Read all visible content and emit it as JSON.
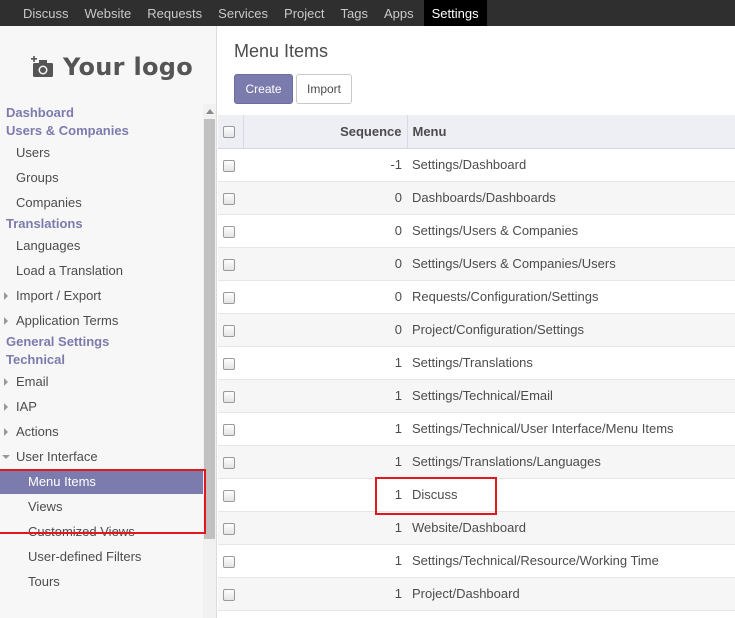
{
  "topnav": {
    "items": [
      "Discuss",
      "Website",
      "Requests",
      "Services",
      "Project",
      "Tags",
      "Apps",
      "Settings"
    ],
    "active": "Settings"
  },
  "sidebar": {
    "logo_text": "Your logo",
    "menu": [
      {
        "type": "section",
        "label": "Dashboard"
      },
      {
        "type": "section",
        "label": "Users & Companies"
      },
      {
        "type": "item",
        "label": "Users"
      },
      {
        "type": "item",
        "label": "Groups"
      },
      {
        "type": "item",
        "label": "Companies"
      },
      {
        "type": "section",
        "label": "Translations"
      },
      {
        "type": "item",
        "label": "Languages"
      },
      {
        "type": "item",
        "label": "Load a Translation"
      },
      {
        "type": "item",
        "label": "Import / Export",
        "caret": "right"
      },
      {
        "type": "item",
        "label": "Application Terms",
        "caret": "right"
      },
      {
        "type": "section",
        "label": "General Settings"
      },
      {
        "type": "section",
        "label": "Technical"
      },
      {
        "type": "item",
        "label": "Email",
        "caret": "right"
      },
      {
        "type": "item",
        "label": "IAP",
        "caret": "right"
      },
      {
        "type": "item",
        "label": "Actions",
        "caret": "right"
      },
      {
        "type": "item",
        "label": "User Interface",
        "caret": "down"
      },
      {
        "type": "subitem",
        "label": "Menu Items",
        "active": true
      },
      {
        "type": "subitem",
        "label": "Views"
      },
      {
        "type": "subitem",
        "label": "Customized Views"
      },
      {
        "type": "subitem",
        "label": "User-defined Filters"
      },
      {
        "type": "subitem",
        "label": "Tours"
      }
    ]
  },
  "main": {
    "title": "Menu Items",
    "create_label": "Create",
    "import_label": "Import",
    "columns": {
      "sequence": "Sequence",
      "menu": "Menu"
    },
    "rows": [
      {
        "sequence": "-1",
        "menu": "Settings/Dashboard"
      },
      {
        "sequence": "0",
        "menu": "Dashboards/Dashboards"
      },
      {
        "sequence": "0",
        "menu": "Settings/Users & Companies"
      },
      {
        "sequence": "0",
        "menu": "Settings/Users & Companies/Users"
      },
      {
        "sequence": "0",
        "menu": "Requests/Configuration/Settings"
      },
      {
        "sequence": "0",
        "menu": "Project/Configuration/Settings"
      },
      {
        "sequence": "1",
        "menu": "Settings/Translations"
      },
      {
        "sequence": "1",
        "menu": "Settings/Technical/Email"
      },
      {
        "sequence": "1",
        "menu": "Settings/Technical/User Interface/Menu Items"
      },
      {
        "sequence": "1",
        "menu": "Settings/Translations/Languages"
      },
      {
        "sequence": "1",
        "menu": "Discuss"
      },
      {
        "sequence": "1",
        "menu": "Website/Dashboard"
      },
      {
        "sequence": "1",
        "menu": "Settings/Technical/Resource/Working Time"
      },
      {
        "sequence": "1",
        "menu": "Project/Dashboard"
      }
    ]
  },
  "colors": {
    "accent": "#7c7bad",
    "topbar": "#2f2f2f",
    "highlight": "#e0191f"
  }
}
